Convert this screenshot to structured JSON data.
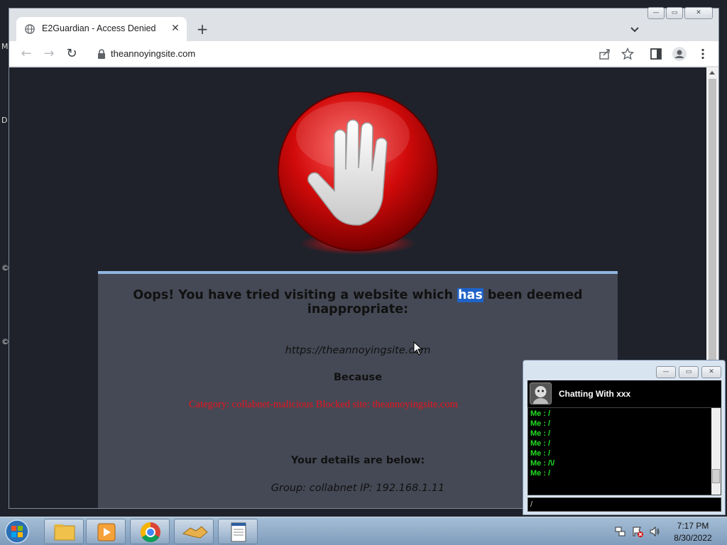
{
  "desktop": {
    "edge_letters": [
      "M",
      "D",
      "©",
      "©"
    ]
  },
  "browser": {
    "tab": {
      "title": "E2Guardian - Access Denied",
      "favicon": "globe-icon",
      "close_glyph": "✕"
    },
    "new_tab_glyph": "+",
    "window_buttons": {
      "minimize": "—",
      "maximize": "▭",
      "close": "✕"
    },
    "address": {
      "url": "theannoyingsite.com",
      "secure_icon": "lock-icon"
    },
    "toolbar_icons": [
      "share-icon",
      "star-icon",
      "side-panel-icon",
      "profile-icon",
      "menu-icon"
    ]
  },
  "page": {
    "heading_before": "Oops! You have tried visiting a website which ",
    "heading_highlight": "has",
    "heading_after": " been deemed inappropriate:",
    "blocked_url": "https://theannoyingsite.com",
    "because_label": "Because",
    "reason": "Category: collabnet-malicious   Blocked site: theannoyingsite.com",
    "details_heading": "Your details are below:",
    "group_ip": "Group: collabnet   IP: 192.168.1.11",
    "accent_color": "#8fb6e0",
    "reason_color": "#e8141e"
  },
  "chat": {
    "title": "Chatting With xxx",
    "messages": [
      "Me : /",
      "Me : /",
      "Me : /",
      "Me : /",
      "Me : /",
      "Me : /\\/",
      "Me : /"
    ],
    "input_value": "/",
    "text_color": "#22dd22"
  },
  "taskbar": {
    "apps": [
      "explorer-icon",
      "media-player-icon",
      "chrome-icon",
      "handshake-icon",
      "notepad-icon"
    ],
    "tray": [
      "network-icon",
      "action-center-icon",
      "volume-icon"
    ],
    "time": "7:17 PM",
    "date": "8/30/2022"
  }
}
